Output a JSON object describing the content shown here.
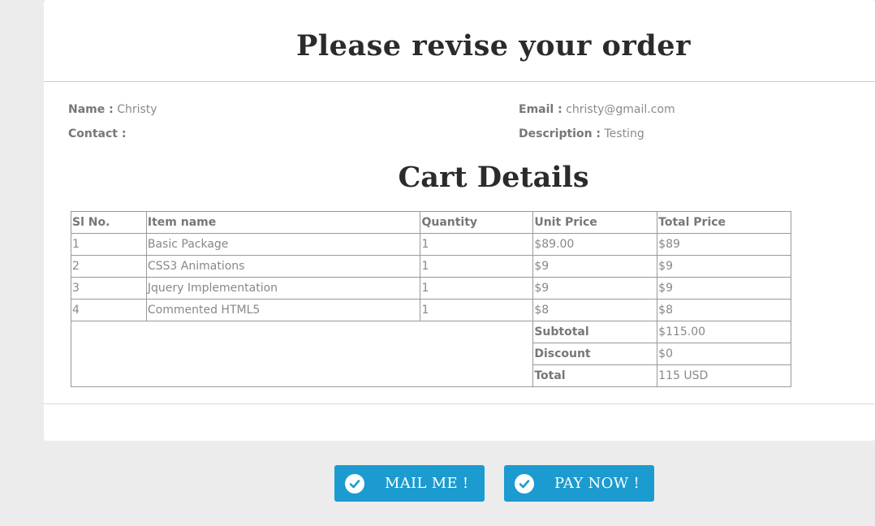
{
  "page": {
    "title": "Please revise your order",
    "cart_title": "Cart Details"
  },
  "customer": {
    "name_label": "Name :",
    "name": "Christy",
    "contact_label": "Contact :",
    "contact": "",
    "email_label": "Email :",
    "email": "christy@gmail.com",
    "description_label": "Description :",
    "description": "Testing"
  },
  "cart": {
    "headers": [
      "Sl No.",
      "Item name",
      "Quantity",
      "Unit Price",
      "Total Price"
    ],
    "rows": [
      [
        "1",
        "Basic Package",
        "1",
        "$89.00",
        "$89"
      ],
      [
        "2",
        "CSS3 Animations",
        "1",
        "$9",
        "$9"
      ],
      [
        "3",
        "Jquery Implementation",
        "1",
        "$9",
        "$9"
      ],
      [
        "4",
        "Commented HTML5",
        "1",
        "$8",
        "$8"
      ]
    ],
    "subtotal_label": "Subtotal",
    "subtotal": "$115.00",
    "discount_label": "Discount",
    "discount": "$0",
    "total_label": "Total",
    "total": "115 USD"
  },
  "buttons": {
    "mail_label": "MAIL ME !",
    "pay_label": "PAY NOW !",
    "icon": "check-circle-icon",
    "color": "#1c9bd0"
  }
}
